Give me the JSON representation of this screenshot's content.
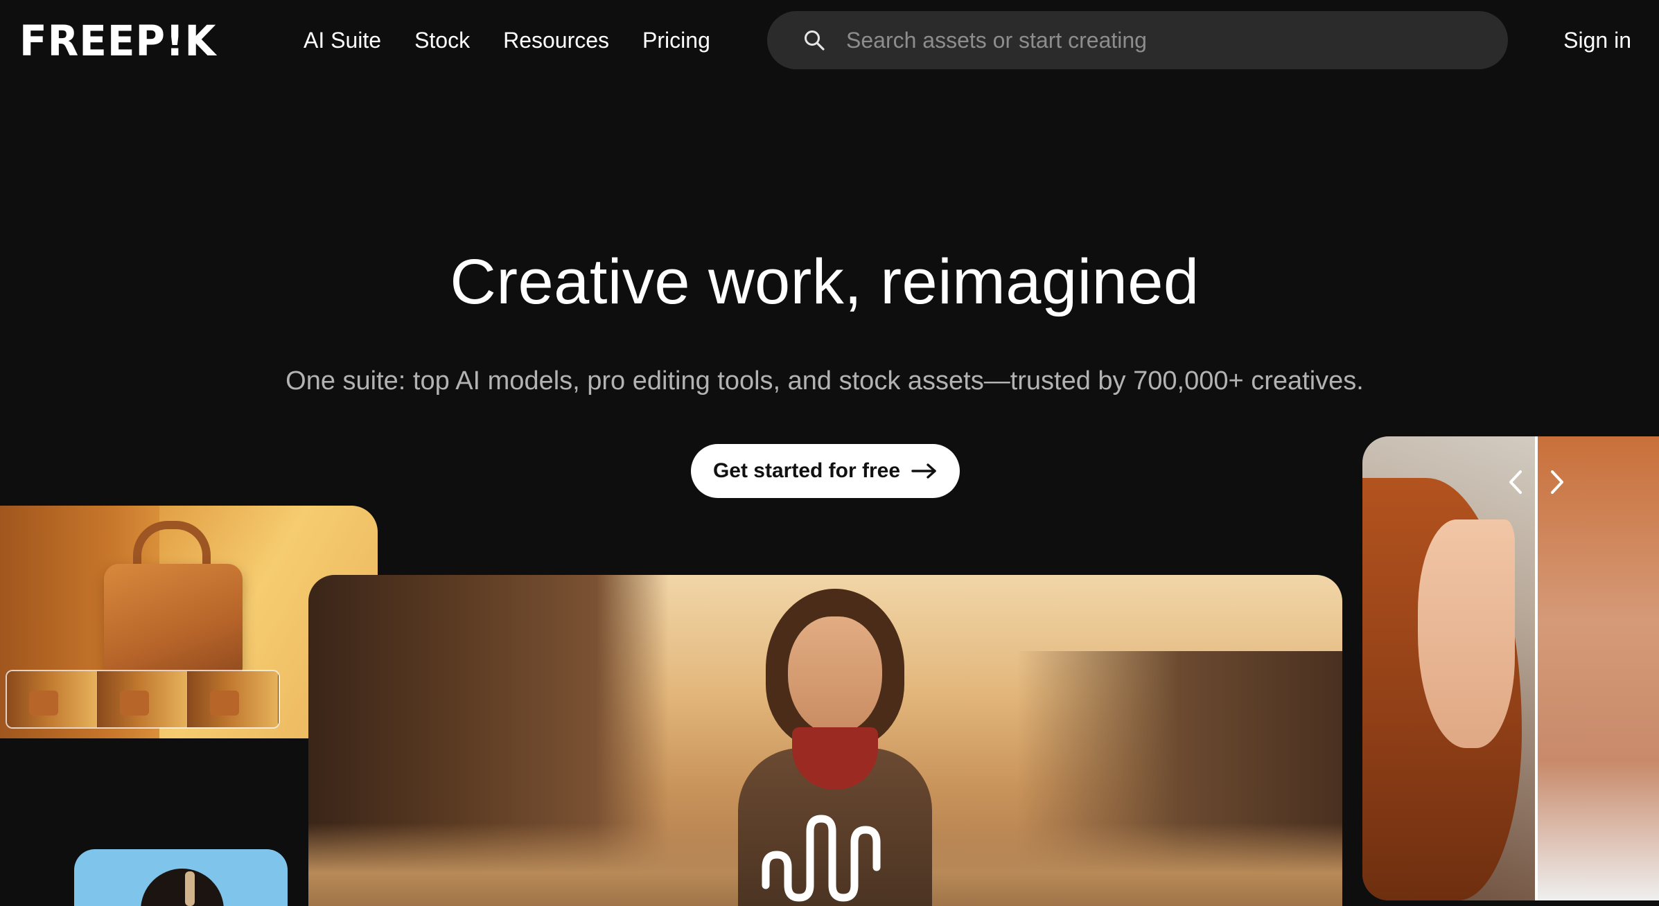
{
  "brand": {
    "logo_text": "FREEP!K"
  },
  "nav": {
    "items": [
      {
        "label": "AI Suite"
      },
      {
        "label": "Stock"
      },
      {
        "label": "Resources"
      },
      {
        "label": "Pricing"
      }
    ]
  },
  "search": {
    "placeholder": "Search assets or start creating",
    "icon": "search-icon"
  },
  "account": {
    "signin_label": "Sign in"
  },
  "hero": {
    "title": "Creative work, reimagined",
    "subtitle": "One suite: top AI models, pro editing tools, and stock assets—trusted by 700,000+ creatives.",
    "cta_label": "Get started for free",
    "cta_icon": "arrow-right-icon"
  },
  "showcase": {
    "cards": [
      {
        "name": "product-bag-card",
        "thumbnails": 3
      },
      {
        "name": "western-video-card",
        "icon": "audio-wave-icon"
      },
      {
        "name": "portrait-compare-card",
        "icons": [
          "chevron-left-icon",
          "chevron-right-icon"
        ]
      },
      {
        "name": "headphones-card"
      }
    ]
  },
  "colors": {
    "background": "#0e0e0e",
    "search_background": "#2b2b2b",
    "placeholder_text": "#8d8d8d",
    "subtitle_text": "#b3b3b3",
    "cta_background": "#ffffff",
    "cta_text": "#111111"
  }
}
